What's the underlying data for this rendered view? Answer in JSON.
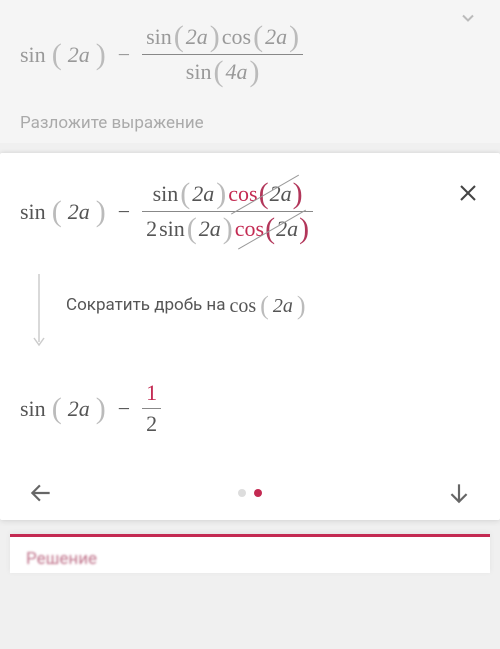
{
  "top": {
    "instruction": "Разложите выражение"
  },
  "step": {
    "text_prefix": "Сократить дробь на",
    "cancel_term": "cos",
    "cancel_arg": "2a"
  },
  "result": {
    "frac_num": "1",
    "frac_den": "2"
  },
  "footer": {
    "label": "Решение"
  },
  "math": {
    "sin": "sin",
    "cos": "cos",
    "arg2a": "2a",
    "arg4a": "4a",
    "two": "2",
    "minus": "−"
  }
}
